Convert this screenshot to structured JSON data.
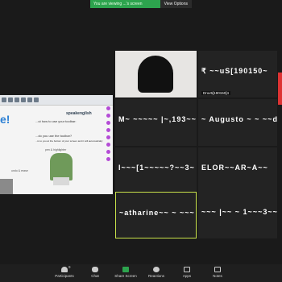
{
  "topbar": {
    "share_status": "You are viewing ...'s screen",
    "view_options": "View Options"
  },
  "shared_slide": {
    "title": "e!",
    "logo": "speakenglish",
    "line1": "...ut how to use your toolbar:",
    "line2": "...do you use the toolbar?",
    "line3": "...is to you at the bottom of your screen and it will automatically",
    "caption1": "pen & highlighter",
    "caption2": "undo & erase"
  },
  "tiles": [
    {
      "name": "",
      "label": ""
    },
    {
      "name": "₹ ~~uS[190150~",
      "label": "Druv5[190150]4"
    },
    {
      "name": "M~ ~~~~~ |~,193~~",
      "label": ""
    },
    {
      "name": "~ Augusto ~ ~ ~~d~~",
      "label": ""
    },
    {
      "name": "I~~~[1~~~~~?~~3~",
      "label": ""
    },
    {
      "name": "ELOR~~AR~A~~",
      "label": ""
    },
    {
      "name": "~atharine~~ ~ ~~~",
      "label": ""
    },
    {
      "name": "~~~ |~~ ~ 1~~~3~~",
      "label": ""
    }
  ],
  "toolbar": {
    "participants_count": "9",
    "participants": "Participants",
    "chat": "Chat",
    "share_screen": "Share Screen",
    "reactions": "Reactions",
    "apps": "Apps",
    "notes": "Notes"
  }
}
